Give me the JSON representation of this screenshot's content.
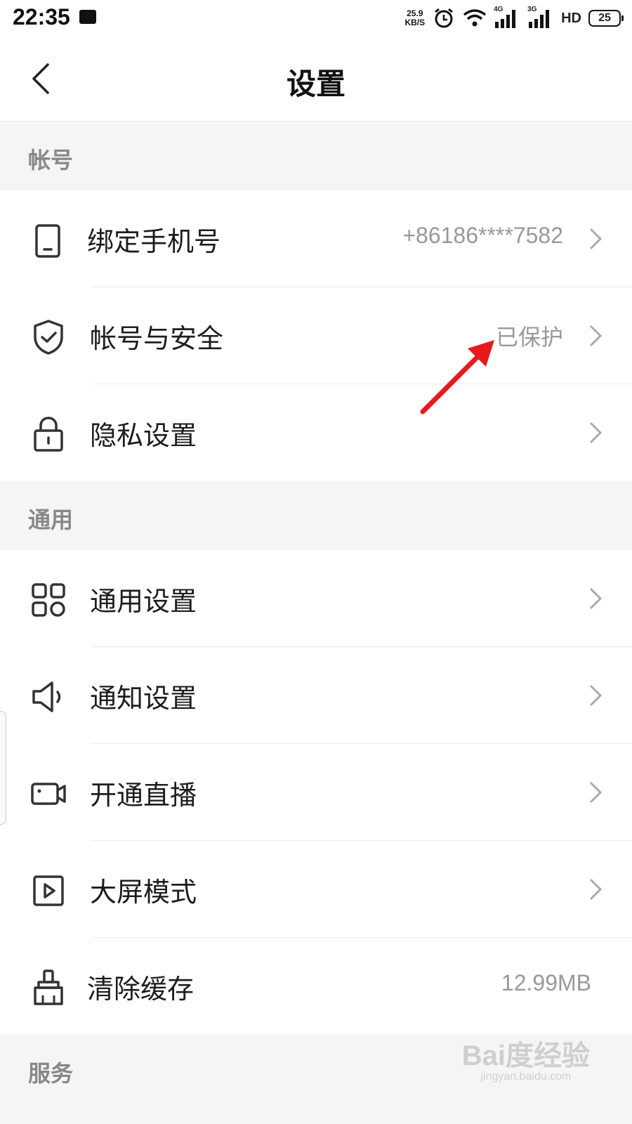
{
  "status_bar": {
    "time": "22:35",
    "net_speed_value": "25.9",
    "net_speed_unit": "KB/S",
    "battery": "25",
    "signal_labels": [
      "4G",
      "3G",
      "HD"
    ]
  },
  "header": {
    "title": "设置"
  },
  "sections": {
    "account": {
      "title": "帐号",
      "items": [
        {
          "label": "绑定手机号",
          "value": "+86186****7582",
          "icon": "phone-icon"
        },
        {
          "label": "帐号与安全",
          "value": "已保护",
          "icon": "shield-icon"
        },
        {
          "label": "隐私设置",
          "value": "",
          "icon": "lock-icon"
        }
      ]
    },
    "general": {
      "title": "通用",
      "items": [
        {
          "label": "通用设置",
          "value": "",
          "icon": "grid-icon"
        },
        {
          "label": "通知设置",
          "value": "",
          "icon": "speaker-icon"
        },
        {
          "label": "开通直播",
          "value": "",
          "icon": "camera-icon"
        },
        {
          "label": "大屏模式",
          "value": "",
          "icon": "play-icon"
        },
        {
          "label": "清除缓存",
          "value": "12.99MB",
          "icon": "broom-icon"
        }
      ]
    },
    "service": {
      "title": "服务"
    }
  },
  "annotation": {
    "color": "#e8191c"
  },
  "watermark": {
    "brand": "Bai度经验",
    "url": "jingyan.baidu.com"
  }
}
